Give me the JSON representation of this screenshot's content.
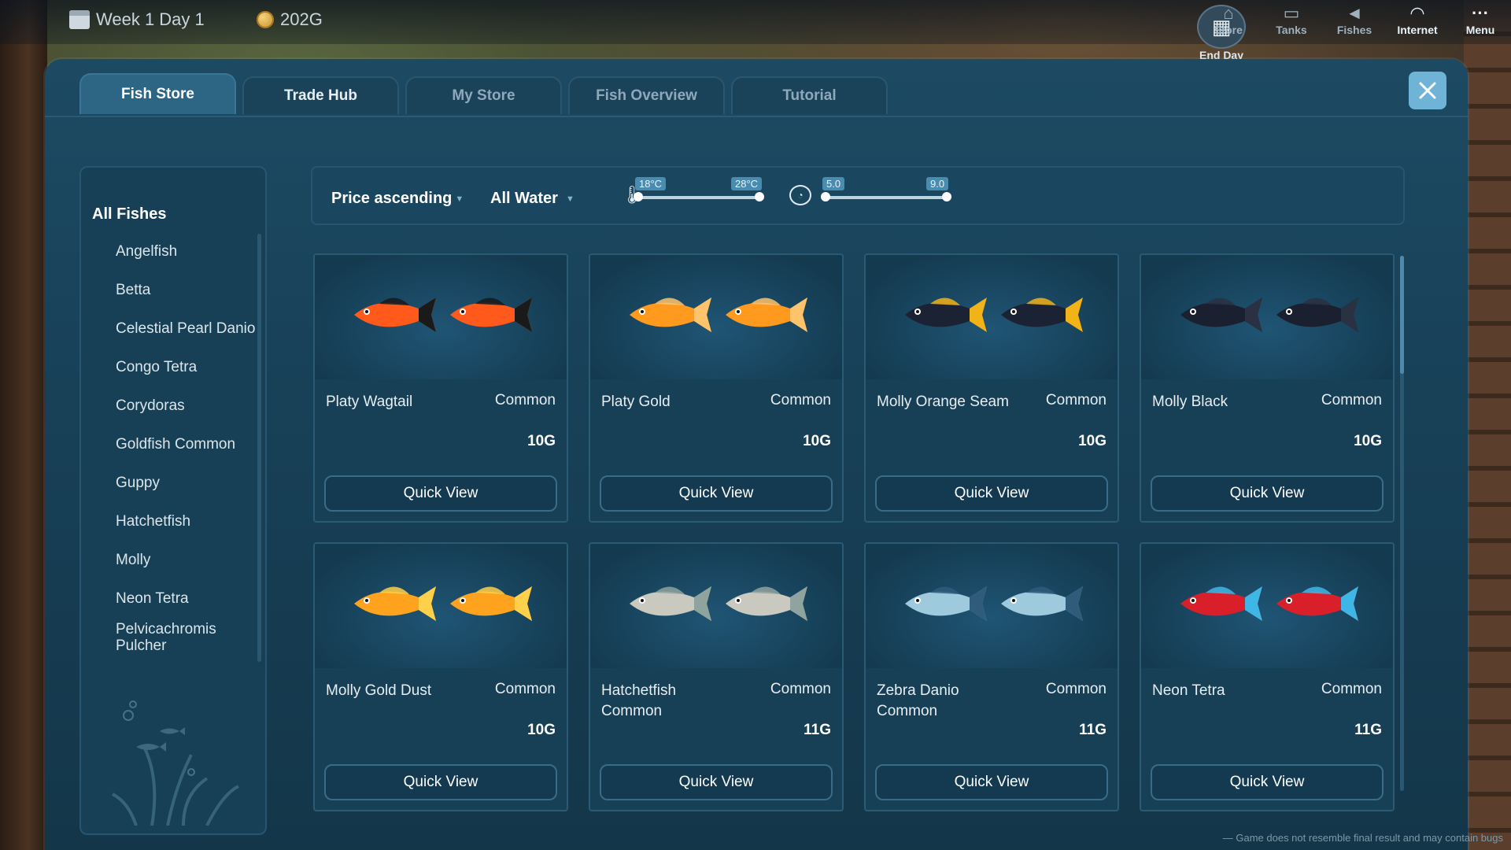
{
  "topbar": {
    "day": "Week 1 Day 1",
    "gold": "202G",
    "end_day": "End Day",
    "buttons": [
      {
        "label": "Store",
        "icon": "store-icon"
      },
      {
        "label": "Tanks",
        "icon": "tanks-icon"
      },
      {
        "label": "Fishes",
        "icon": "fishes-icon"
      },
      {
        "label": "Internet",
        "icon": "wifi-icon"
      },
      {
        "label": "Menu",
        "icon": "menu-dots-icon"
      }
    ]
  },
  "tabs": [
    "Fish Store",
    "Trade Hub",
    "My Store",
    "Fish Overview",
    "Tutorial"
  ],
  "active_tab": "Fish Store",
  "sidebar": {
    "title": "All Fishes",
    "items": [
      "Angelfish",
      "Betta",
      "Celestial Pearl Danio",
      "Congo Tetra",
      "Corydoras",
      "Goldfish Common",
      "Guppy",
      "Hatchetfish",
      "Molly",
      "Neon Tetra",
      "Pelvicachromis Pulcher"
    ]
  },
  "filters": {
    "sort": "Price ascending",
    "water": "All Water",
    "temp_min": "18°C",
    "temp_max": "28°C",
    "ph_min": "5.0",
    "ph_max": "9.0"
  },
  "cards": [
    {
      "name": "Platy Wagtail",
      "rarity": "Common",
      "price": "10G",
      "button": "Quick View",
      "colors": [
        "#ff5a1c",
        "#1a1a1a"
      ]
    },
    {
      "name": "Platy Gold",
      "rarity": "Common",
      "price": "10G",
      "button": "Quick View",
      "colors": [
        "#ff9a1f",
        "#ffc36b"
      ]
    },
    {
      "name": "Molly Orange Seam",
      "rarity": "Common",
      "price": "10G",
      "button": "Quick View",
      "colors": [
        "#1b2233",
        "#f2b318"
      ]
    },
    {
      "name": "Molly Black",
      "rarity": "Common",
      "price": "10G",
      "button": "Quick View",
      "colors": [
        "#1a2030",
        "#2a3142"
      ]
    },
    {
      "name": "Molly Gold Dust",
      "rarity": "Common",
      "price": "10G",
      "button": "Quick View",
      "colors": [
        "#ffa21e",
        "#ffd04a"
      ]
    },
    {
      "name": "Hatchetfish Common",
      "rarity": "Common",
      "price": "11G",
      "button": "Quick View",
      "colors": [
        "#c9c9c0",
        "#8fa39f"
      ]
    },
    {
      "name": "Zebra Danio Common",
      "rarity": "Common",
      "price": "11G",
      "button": "Quick View",
      "colors": [
        "#9fc9dd",
        "#2e5c7a"
      ]
    },
    {
      "name": "Neon Tetra",
      "rarity": "Common",
      "price": "11G",
      "button": "Quick View",
      "colors": [
        "#d81f2a",
        "#3fb7e6"
      ]
    }
  ],
  "disclaimer": "— Game does not resemble final result and may contain bugs"
}
